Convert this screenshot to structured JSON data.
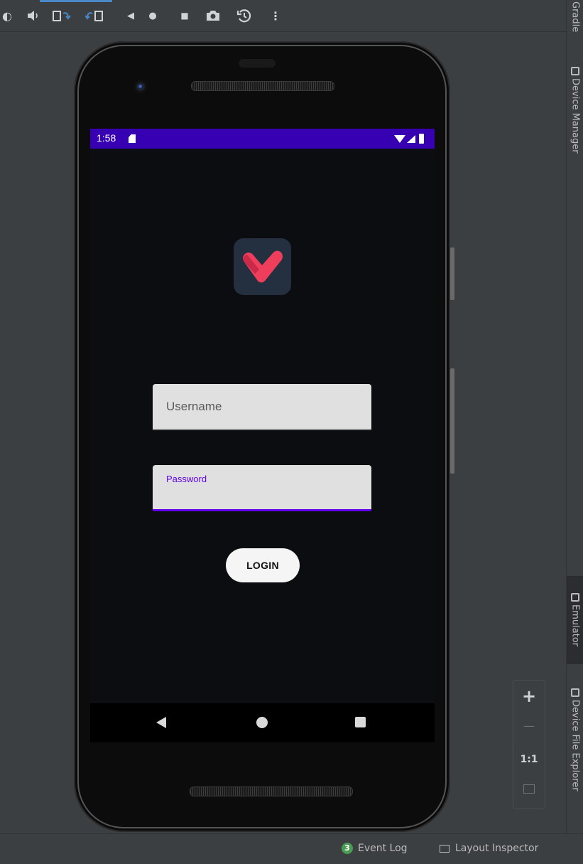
{
  "toolbar": {
    "icons": [
      "power-icon",
      "volume-up-icon",
      "rotate-left-icon",
      "rotate-right-icon",
      "back-icon",
      "home-icon",
      "overview-icon",
      "screenshot-icon",
      "snapshot-icon",
      "more-icon"
    ],
    "glyphs": {
      "power": "◐",
      "volume": "◀)",
      "back": "◀",
      "home": "●",
      "overview": "■",
      "more": "⋮"
    }
  },
  "right_tool_windows": {
    "gradle": "Gradle",
    "device_manager": "Device Manager",
    "emulator": "Emulator",
    "device_file_explorer": "Device File Explorer"
  },
  "zoom_panel": {
    "zoom_in": "+",
    "zoom_out": "—",
    "actual_size": "1:1"
  },
  "status_bar": {
    "event_log_count": "3",
    "event_log_label": "Event Log",
    "layout_inspector_label": "Layout Inspector"
  },
  "device": {
    "status_bar": {
      "time": "1:58",
      "color": "#3700b3"
    },
    "app": {
      "background": "#0b0d11",
      "logo_colors": {
        "tile": "#243040",
        "heart": "#ef3e5c"
      },
      "username_placeholder": "Username",
      "password_label": "Password",
      "login_label": "LOGIN",
      "accent": "#6200ee"
    }
  }
}
